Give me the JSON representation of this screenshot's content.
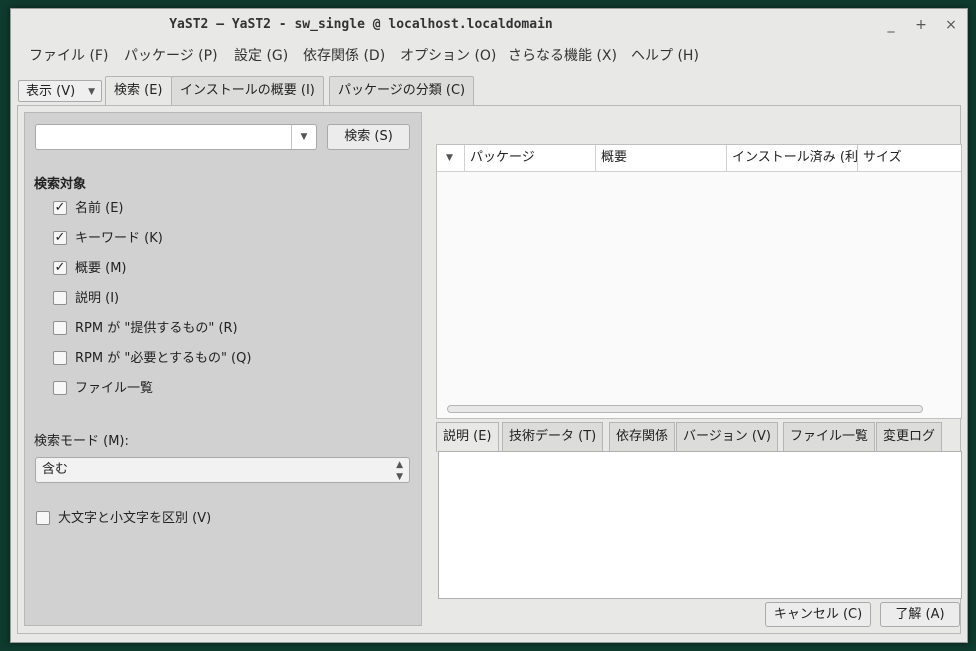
{
  "window": {
    "title": "YaST2 – YaST2 - sw_single @ localhost.localdomain",
    "controls": {
      "minimize": "_",
      "maximize": "+",
      "close": "×"
    }
  },
  "menubar": [
    "ファイル (F)",
    "パッケージ (P)",
    "設定 (G)",
    "依存関係 (D)",
    "オプション (O)",
    "さらなる機能 (X)",
    "ヘルプ (H)"
  ],
  "view_button": {
    "label": "表示 (V)"
  },
  "top_tabs": [
    "検索 (E)",
    "インストールの概要 (I)",
    "パッケージの分類 (C)"
  ],
  "search": {
    "query": "",
    "button": "検索 (S)",
    "target_heading": "検索対象",
    "targets": [
      {
        "label": "名前 (E)",
        "checked": true
      },
      {
        "label": "キーワード (K)",
        "checked": true
      },
      {
        "label": "概要 (M)",
        "checked": true
      },
      {
        "label": "説明 (I)",
        "checked": false
      },
      {
        "label": "RPM が \"提供するもの\" (R)",
        "checked": false
      },
      {
        "label": "RPM が \"必要とするもの\" (Q)",
        "checked": false
      },
      {
        "label": "ファイル一覧",
        "checked": false
      }
    ],
    "mode_label": "検索モード (M):",
    "mode_value": "含む",
    "case_sensitive": {
      "label": "大文字と小文字を区別 (V)",
      "checked": false
    }
  },
  "package_table": {
    "columns": [
      "パッケージ",
      "概要",
      "インストール済み (利",
      "サイズ"
    ]
  },
  "info_tabs": [
    "説明 (E)",
    "技術データ (T)",
    "依存関係",
    "バージョン (V)",
    "ファイル一覧",
    "変更ログ"
  ],
  "buttons": {
    "cancel": "キャンセル (C)",
    "ok": "了解 (A)"
  },
  "colors": {
    "desktop": "#0f3a2e",
    "window_bg": "#e8e8e7",
    "panel_bg": "#d1d1d1"
  }
}
